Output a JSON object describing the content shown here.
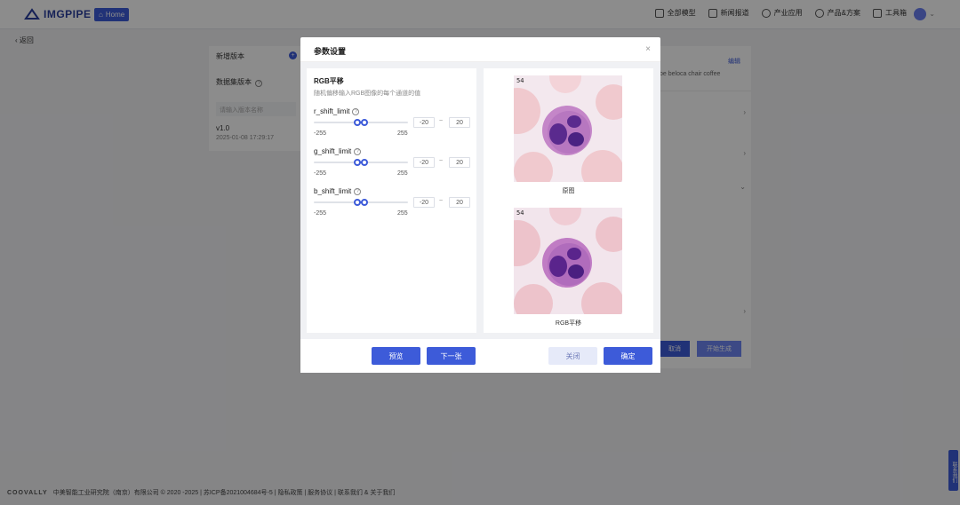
{
  "app": {
    "logo_text": "IMGPIPE",
    "home_label": "Home"
  },
  "nav": {
    "items": [
      {
        "label": "全部模型",
        "icon": "cube-icon"
      },
      {
        "label": "新闻报道",
        "icon": "news-icon"
      },
      {
        "label": "产业应用",
        "icon": "industry-icon"
      },
      {
        "label": "产品&方案",
        "icon": "bulb-icon"
      },
      {
        "label": "工具箱",
        "icon": "toolbox-icon"
      }
    ]
  },
  "back_label": "返回",
  "left_panel": {
    "add_version": "新增版本",
    "dataset_version": "数据集版本",
    "search_placeholder": "请输入版本名称",
    "version_name": "v1.0",
    "version_time": "2025-01-08 17:29:17"
  },
  "right_panel": {
    "edit_label": "编辑",
    "snippet": "be beloca chair coffee",
    "cancel_label": "取消",
    "start_label": "开始生成"
  },
  "modal": {
    "title": "参数设置",
    "close_glyph": "×",
    "aug_title": "RGB平移",
    "aug_desc": "随机偏移输入RGB图像的每个通道的值",
    "params": [
      {
        "name": "r_shift_limit",
        "min": -255,
        "max": 255,
        "value_low": -20,
        "value_high": 20,
        "min_label": "-255",
        "max_label": "255",
        "low_label": "-20",
        "high_label": "20"
      },
      {
        "name": "g_shift_limit",
        "min": -255,
        "max": 255,
        "value_low": -20,
        "value_high": 20,
        "min_label": "-255",
        "max_label": "255",
        "low_label": "-20",
        "high_label": "20"
      },
      {
        "name": "b_shift_limit",
        "min": -255,
        "max": 255,
        "value_low": -20,
        "value_high": 20,
        "min_label": "-255",
        "max_label": "255",
        "low_label": "-20",
        "high_label": "20"
      }
    ],
    "range_sep": "~",
    "original_caption": "原图",
    "result_caption": "RGB平移",
    "image_number": "54",
    "buttons": {
      "preview": "预览",
      "next": "下一张",
      "close": "关闭",
      "confirm": "确定"
    }
  },
  "footer": {
    "brand": "COOVALLY",
    "text": "中美智能工业研究院（南京）有限公司 © 2020 -2025 | 苏ICP备2021004684号-5 | 隐私政策 | 服务协议 | 联系我们 & 关于我们"
  },
  "contact_tab": "联系我们",
  "colors": {
    "primary": "#3d5bd9",
    "primary_light": "#e6eaf9"
  }
}
